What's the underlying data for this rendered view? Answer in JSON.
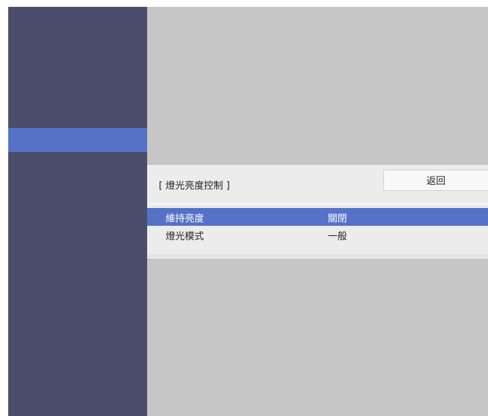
{
  "submenu": {
    "title": "[ 燈光亮度控制 ]",
    "back_label": "返回",
    "items": [
      {
        "label": "維持亮度",
        "value": "關閉",
        "selected": true
      },
      {
        "label": "燈光模式",
        "value": "一般",
        "selected": false
      }
    ]
  },
  "colors": {
    "sidebar": "#4a4e6b",
    "highlight": "#5572c8",
    "background": "#c6c6c6",
    "panel": "#ececec"
  }
}
